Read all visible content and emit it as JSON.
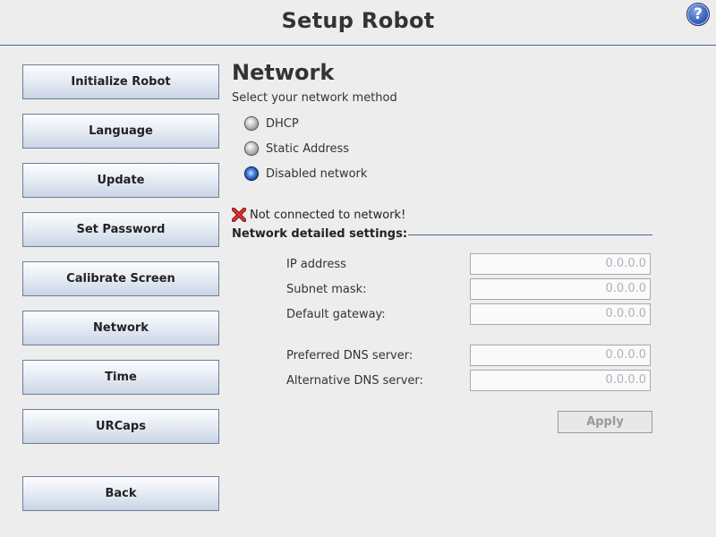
{
  "header": {
    "title": "Setup Robot",
    "help_label": "?"
  },
  "sidebar": {
    "items": [
      {
        "label": "Initialize Robot"
      },
      {
        "label": "Language"
      },
      {
        "label": "Update"
      },
      {
        "label": "Set Password"
      },
      {
        "label": "Calibrate Screen"
      },
      {
        "label": "Network"
      },
      {
        "label": "Time"
      },
      {
        "label": "URCaps"
      }
    ],
    "back_label": "Back"
  },
  "network": {
    "title": "Network",
    "subtitle": "Select your network method",
    "methods": [
      {
        "label": "DHCP",
        "selected": false
      },
      {
        "label": "Static Address",
        "selected": false
      },
      {
        "label": "Disabled network",
        "selected": true
      }
    ],
    "status": "Not connected to network!",
    "section_title": "Network detailed settings:",
    "fields": [
      {
        "label": "IP address",
        "value": "0.0.0.0"
      },
      {
        "label": "Subnet mask:",
        "value": "0.0.0.0"
      },
      {
        "label": "Default gateway:",
        "value": "0.0.0.0"
      },
      {
        "label": "Preferred DNS server:",
        "value": "0.0.0.0"
      },
      {
        "label": "Alternative DNS server:",
        "value": "0.0.0.0"
      }
    ],
    "apply_label": "Apply"
  },
  "colors": {
    "accent": "#4a6a9a",
    "status_error": "#cc2222",
    "radio_selected": "#1a3e8a"
  },
  "icons": {
    "help": "help-icon",
    "status": "x-icon"
  }
}
